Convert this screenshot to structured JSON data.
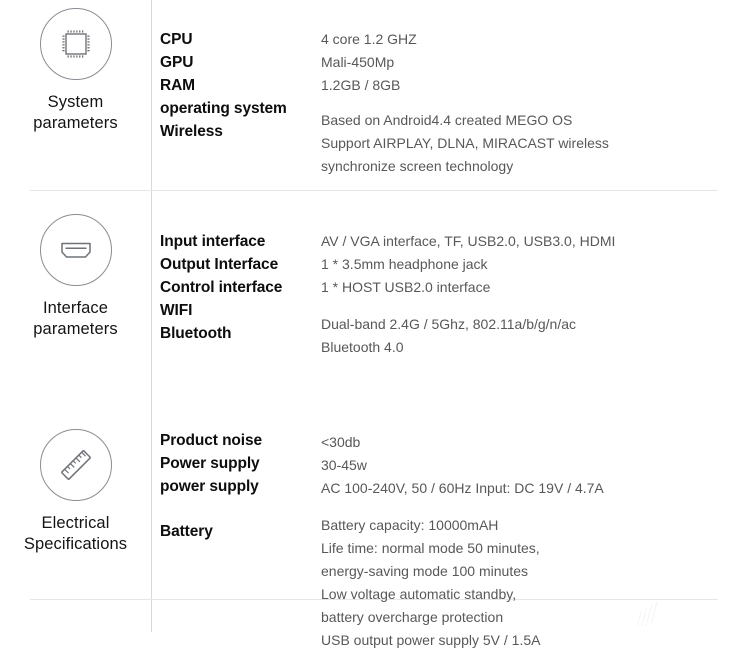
{
  "document": {
    "title": "Product Specification Sheet"
  },
  "sections": [
    {
      "id": "system-parameters",
      "category": "System\nparameters",
      "category_line_1": "System",
      "category_line_2": "parameters",
      "icon": "cpu-chip-icon",
      "labels": [
        "CPU",
        "GPU",
        "RAM",
        "operating system",
        "Wireless"
      ],
      "value_groups": [
        {
          "lines": [
            "4 core 1.2 GHZ",
            "Mali-450Mp",
            "1.2GB / 8GB"
          ]
        },
        {
          "lines": [
            "Based on Android4.4 created MEGO OS",
            "Support AIRPLAY, DLNA, MIRACAST wireless",
            "synchronize screen technology"
          ]
        }
      ]
    },
    {
      "id": "interface-parameters",
      "category": "Interface\nparameters",
      "category_line_1": "Interface",
      "category_line_2": "parameters",
      "icon": "hdmi-port-icon",
      "labels": [
        "Input interface",
        "Output Interface",
        "Control interface",
        "WIFI",
        "Bluetooth"
      ],
      "value_groups": [
        {
          "lines": [
            "AV / VGA interface, TF,  USB2.0, USB3.0, HDMI",
            "1 * 3.5mm headphone jack",
            "1 * HOST USB2.0 interface"
          ]
        },
        {
          "lines": [
            "Dual-band 2.4G / 5Ghz, 802.11a/b/g/n/ac",
            "Bluetooth 4.0"
          ]
        }
      ]
    },
    {
      "id": "electrical-specifications",
      "category": "Electrical\nSpecifications",
      "category_line_1": "Electrical",
      "category_line_2": "Specifications",
      "icon": "ruler-icon",
      "labels": [
        "Product noise",
        "Power supply",
        "power supply",
        "",
        "Battery"
      ],
      "value_groups": [
        {
          "lines": [
            "<30db",
            "30-45w",
            "AC 100-240V, 50 / 60Hz Input: DC 19V / 4.7A"
          ]
        },
        {
          "lines": [
            "Battery capacity: 10000mAH",
            "Life time: normal mode 50 minutes,",
            "energy-saving mode 100 minutes",
            "Low voltage automatic standby,",
            "battery overcharge protection",
            "USB output power supply 5V / 1.5A"
          ]
        }
      ]
    }
  ],
  "colors": {
    "background": "#ffffff",
    "label_text": "#0d0d0d",
    "value_text": "#585858",
    "category_text": "#141414",
    "divider": "#e6e6e6",
    "vertical_rule": "#d9d9d9",
    "icon_stroke": "#8a8d93"
  }
}
